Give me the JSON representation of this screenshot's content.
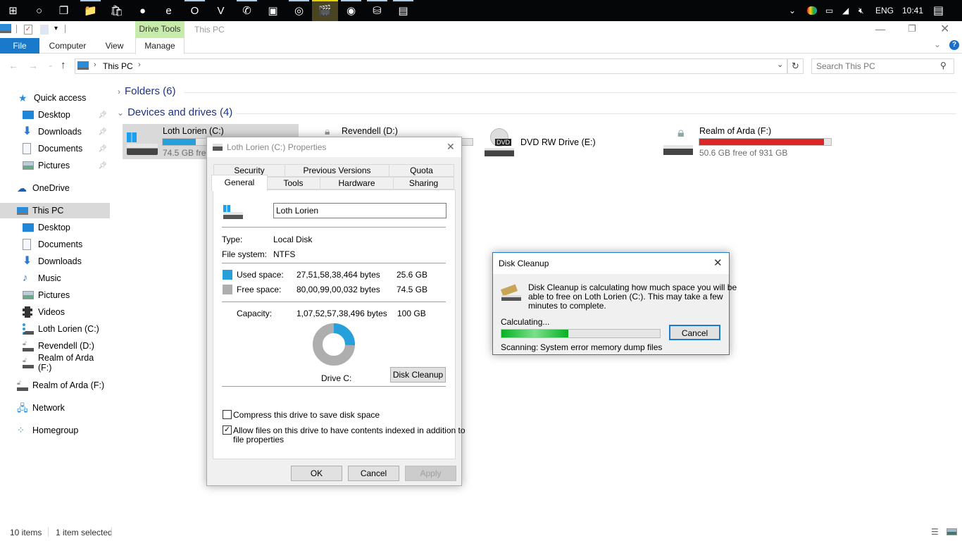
{
  "taskbar": {
    "apps": [
      {
        "name": "start-icon",
        "glyph": "⊞"
      },
      {
        "name": "cortana-icon",
        "glyph": "○"
      },
      {
        "name": "task-view-icon",
        "glyph": "❐"
      },
      {
        "name": "file-explorer-icon",
        "glyph": "📁"
      },
      {
        "name": "store-icon",
        "glyph": "🛍"
      },
      {
        "name": "app-orange-icon",
        "glyph": "●"
      },
      {
        "name": "edge-icon",
        "glyph": "e"
      },
      {
        "name": "opera-icon",
        "glyph": "O"
      },
      {
        "name": "vivaldi-icon",
        "glyph": "V"
      },
      {
        "name": "whatsapp-icon",
        "glyph": "✆"
      },
      {
        "name": "app-green-icon",
        "glyph": "▣"
      },
      {
        "name": "groove-icon",
        "glyph": "◎"
      },
      {
        "name": "media-player-icon",
        "glyph": "🎬"
      },
      {
        "name": "app-blue-globe-icon",
        "glyph": "◉"
      },
      {
        "name": "usb-drive-icon",
        "glyph": "⛁"
      },
      {
        "name": "drive-app-icon",
        "glyph": "▤"
      }
    ],
    "tray": {
      "chevron": "⌄",
      "language": "ENG",
      "time": "10:41"
    }
  },
  "window": {
    "title": "This PC",
    "context_tab_group": "Drive Tools",
    "ribbon_tabs": [
      "File",
      "Computer",
      "View",
      "Manage"
    ],
    "address": {
      "root": "This PC"
    },
    "search_placeholder": "Search This PC"
  },
  "sidebar": {
    "quick_access": "Quick access",
    "quick_items": [
      "Desktop",
      "Downloads",
      "Documents",
      "Pictures"
    ],
    "onedrive": "OneDrive",
    "this_pc": "This PC",
    "pc_items": [
      "Desktop",
      "Documents",
      "Downloads",
      "Music",
      "Pictures",
      "Videos",
      "Loth Lorien (C:)",
      "Revendell (D:)",
      "Realm of Arda (F:)"
    ],
    "extra_drive": "Realm of Arda (F:)",
    "network": "Network",
    "homegroup": "Homegroup"
  },
  "content": {
    "folders_header": "Folders (6)",
    "devices_header": "Devices and drives (4)",
    "drives": [
      {
        "name": "Loth Lorien (C:)",
        "free_text": "74.5 GB free of 100 GB",
        "used_fraction": 0.256,
        "bar_color": "#26a0da"
      },
      {
        "name": "Revendell (D:)",
        "free_text": "",
        "used_fraction": 0,
        "bar_color": "#26a0da"
      },
      {
        "name": "DVD RW Drive (E:)",
        "free_text": ""
      },
      {
        "name": "Realm of Arda (F:)",
        "free_text": "50.6 GB free of 931 GB",
        "used_fraction": 0.946,
        "bar_color": "#da2626"
      }
    ]
  },
  "status": {
    "items": "10 items",
    "selected": "1 item selected"
  },
  "properties": {
    "title": "Loth Lorien (C:) Properties",
    "tabs_row1": [
      "Security",
      "Previous Versions",
      "Quota"
    ],
    "tabs_row2": [
      "General",
      "Tools",
      "Hardware",
      "Sharing"
    ],
    "label_value": "Loth Lorien",
    "type_label": "Type:",
    "type_value": "Local Disk",
    "fs_label": "File system:",
    "fs_value": "NTFS",
    "used_label": "Used space:",
    "used_bytes": "27,51,58,38,464 bytes",
    "used_gb": "25.6 GB",
    "free_label": "Free space:",
    "free_bytes": "80,00,99,00,032 bytes",
    "free_gb": "74.5 GB",
    "cap_label": "Capacity:",
    "cap_bytes": "1,07,52,57,38,496 bytes",
    "cap_gb": "100 GB",
    "used_fraction": 0.256,
    "used_color": "#26a0da",
    "free_color": "#aeaeae",
    "drive_caption": "Drive C:",
    "cleanup_btn": "Disk Cleanup",
    "compress_label": "Compress this drive to save disk space",
    "compress_checked": false,
    "index_label_1": "Allow files on this drive to have contents indexed in addition to",
    "index_label_2": "file properties",
    "index_checked": true,
    "ok": "OK",
    "cancel": "Cancel",
    "apply": "Apply"
  },
  "cleanup": {
    "title": "Disk Cleanup",
    "message_1": "Disk Cleanup is calculating how much space you will be",
    "message_2": "able to free on Loth Lorien (C:). This may take a few",
    "message_3": "minutes to complete.",
    "calculating": "Calculating...",
    "progress": 0.42,
    "cancel": "Cancel",
    "scanning_label": "Scanning:",
    "scanning_item": "System error memory dump files"
  }
}
